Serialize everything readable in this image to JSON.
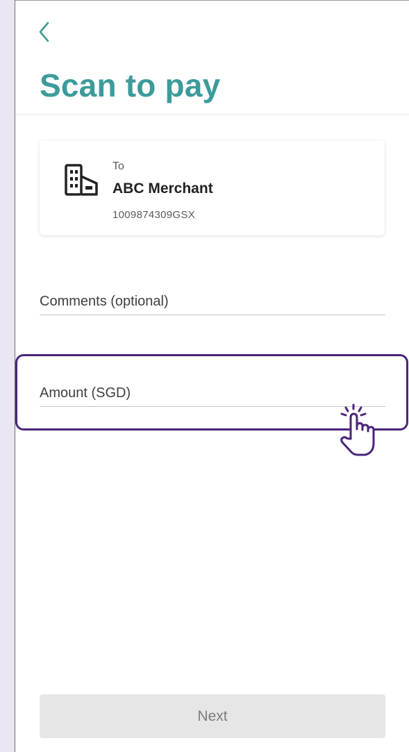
{
  "header": {
    "back_icon": "chevron-left-icon",
    "title": "Scan to pay"
  },
  "merchant": {
    "icon": "building-icon",
    "to_label": "To",
    "name": "ABC Merchant",
    "id": "1009874309GSX"
  },
  "form": {
    "comments_label": "Comments (optional)",
    "amount_label": "Amount (SGD)"
  },
  "footer": {
    "next_label": "Next"
  },
  "overlay": {
    "pointer_icon": "tap-hand-icon"
  },
  "colors": {
    "accent": "#3d9b9b",
    "highlight": "#4a2479",
    "side_strip": "#ece6f3",
    "disabled_button": "#e6e6e6"
  }
}
